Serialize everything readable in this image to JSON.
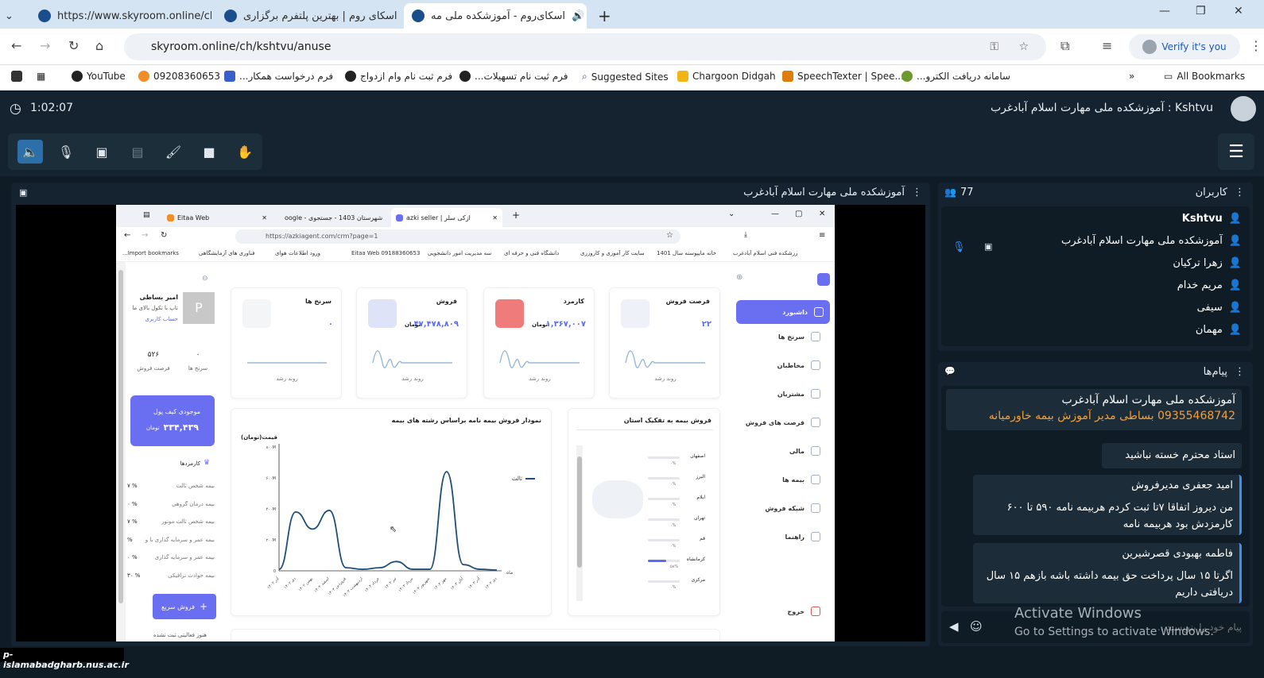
{
  "tabs": [
    {
      "title": "https://www.skyroom.online/ch",
      "close": "✕"
    },
    {
      "title": "اسکای روم | بهترین پلتفرم برگزاری",
      "close": "✕"
    },
    {
      "title": "اسکای‌روم - آموزشکده ملی مه",
      "close": "✕"
    }
  ],
  "address": {
    "url": "skyroom.online/ch/kshtvu/anuse",
    "verify": "Verify it's you"
  },
  "bookmarks": [
    "YouTube",
    "09208360653",
    "فرم درخواست همکار...",
    "فرم ثبت نام وام ازدواج",
    "فرم ثبت نام تسهیلات...",
    "Suggested Sites",
    "Chargoon Didgah",
    "SpeechTexter | Spee...",
    "سامانه دریافت الکترو...",
    "All Bookmarks"
  ],
  "room": {
    "timer": "1:02:07",
    "title": "Kshtvu : آموزشکده ملی مهارت اسلام آبادغرب"
  },
  "stage": {
    "title": "آموزشکده ملی مهارت اسلام آبادغرب"
  },
  "users": {
    "title": "کاربران",
    "count": "77",
    "list": [
      "Kshtvu",
      "آموزشکده ملی مهارت اسلام آبادغرب",
      "زهرا ترکیان",
      "مریم خدام",
      "سیفی",
      "مهمان"
    ]
  },
  "messages": {
    "title": "پیام‌ها",
    "items": [
      {
        "sender": "آموزشکده ملی مهارت اسلام آبادغرب",
        "text": "09355468742 بساطی مدیر آموزش بیمه خاورمیانه"
      },
      {
        "sender": "",
        "text": "استاد محترم خسته نباشید"
      },
      {
        "sender": "امید جعفری مدیرفروش",
        "text": "من دیروز اتفاقا ۷تا ثبت کردم هربیمه نامه ۵۹۰ تا ۶۰۰ کارمزدش بود هربیمه نامه"
      },
      {
        "sender": "فاطمه بهبودی قصرشیرین",
        "text": "اگرتا ۱۵ سال پرداخت حق بیمه داشته باشه بازهم ۱۵ سال دریافتی داریم"
      }
    ],
    "placeholder": "پیام خود را بنویسید..."
  },
  "watermark": {
    "line1": "Activate Windows",
    "line2": "Go to Settings to activate Windows."
  },
  "footer_domain": "p-islamabadgharb.nus.ac.ir",
  "shared_screen": {
    "tabs": [
      "Eitaa Web",
      "oogle - شهرستان 1403 - جستجوی",
      "azki seller | ازکی سلر"
    ],
    "url": "https://azkiagent.com/crm?page=1",
    "bookmarks": [
      "Import bookmarks...",
      "فناوری های آزمایشگاهی",
      "ورود اطلاعات هوای",
      "Eitaa Web 09188360653",
      "سه مدیریت امور دانشجویی",
      "دانشگاه فنی و حرفه ای",
      "سایت کار آموزی و کاروزری",
      "خانه مایپوسته سال 1401",
      "رزشکده فنی اسلام آبادغرب"
    ],
    "profile": {
      "name": "امیر بساطی",
      "line1": "تاپ با تکول بالای ما",
      "link": "حساب کاربری",
      "s1_val": "۰",
      "s1_label": "سرنخ ها",
      "s2_val": "۵۲۶",
      "s2_label": "فرصت فروش",
      "initial": "P"
    },
    "wallet": {
      "label": "موجودی کیف پول",
      "value": "۳۳۴,۴۳۹",
      "unit": "تومان"
    },
    "commissions_title": "کارمزدها",
    "commissions": [
      {
        "label": "بیمه شخص ثالث",
        "value": "۷ %"
      },
      {
        "label": "بیمه درمان گروهی",
        "value": "۰ %"
      },
      {
        "label": "بیمه شخص ثالث موتور",
        "value": "۷ %"
      },
      {
        "label": "بیمه عمر و سرمایه گذاری با وام بانکی",
        "value": "%"
      },
      {
        "label": "بیمه عمر و سرمایه گذاری",
        "value": "۰ %"
      },
      {
        "label": "بیمه حوادث ترافیکی",
        "value": "۳۰ %"
      }
    ],
    "quick_sale": "فروش سریع",
    "activity": "هنوز فعالیتی ثبت نشده",
    "cards": [
      {
        "title": "فرصت فروش",
        "value": "۲۲",
        "unit": "",
        "trend": "روند رشد"
      },
      {
        "title": "کارمزد",
        "value": "۱,۳۶۷,۰۰۷",
        "unit": "تومان",
        "trend": "روند رشد"
      },
      {
        "title": "فروش",
        "value": "۴۷,۴۷۸,۸۰۹",
        "unit": "تومان",
        "trend": "روند رشد"
      },
      {
        "title": "سرنخ ها",
        "value": "۰",
        "unit": "",
        "trend": "روند رشد"
      }
    ],
    "nav": [
      "داشبورد",
      "سرنخ ها",
      "مخاطبان",
      "مشتریان",
      "فرصت های فروش",
      "مالی",
      "بیمه ها",
      "شبکه فروش",
      "راهنما",
      "خروج"
    ],
    "province_title": "فروش بیمه به تفکیک استان",
    "provinces": [
      {
        "name": "اصفهان",
        "pct": "۰%"
      },
      {
        "name": "البرز",
        "pct": "۰%"
      },
      {
        "name": "ایلام",
        "pct": "۰%"
      },
      {
        "name": "تهران",
        "pct": "۰%"
      },
      {
        "name": "قم",
        "pct": "۰%"
      },
      {
        "name": "کرمانشاه",
        "pct": "۵۸%"
      },
      {
        "name": "مرکزی",
        "pct": "۰%"
      }
    ]
  },
  "chart_data": {
    "type": "line",
    "title": "نمودار فروش بیمه نامه براساس رشته های بیمه",
    "ylabel": "قیمت(تومان)",
    "xlabel": "ماه",
    "yticks": [
      "0",
      "۲۰۰M",
      "۴۰۰M",
      "۶۰۰M",
      "۸۰۰M"
    ],
    "ylim": [
      0,
      800
    ],
    "categories": [
      "آذر ۱۴۰۲",
      "دی ۱۴۰۲",
      "بهمن ۱۴۰۲",
      "اسفند ۱۴۰۲",
      "فروردین ۱۴۰۳",
      "اردیبهشت ۱۴۰۳",
      "خرداد ۱۴۰۳",
      "تیر ۱۴۰۳",
      "مرداد ۱۴۰۳",
      "شهریور ۱۴۰۳",
      "مهر ۱۴۰۳",
      "آبان ۱۴۰۳",
      "آذر ۱۴۰۳",
      "دی ۱۴۰۳"
    ],
    "series": [
      {
        "name": "ثالث",
        "values": [
          10,
          380,
          270,
          390,
          20,
          10,
          20,
          60,
          10,
          10,
          640,
          40,
          10,
          5
        ]
      }
    ]
  }
}
